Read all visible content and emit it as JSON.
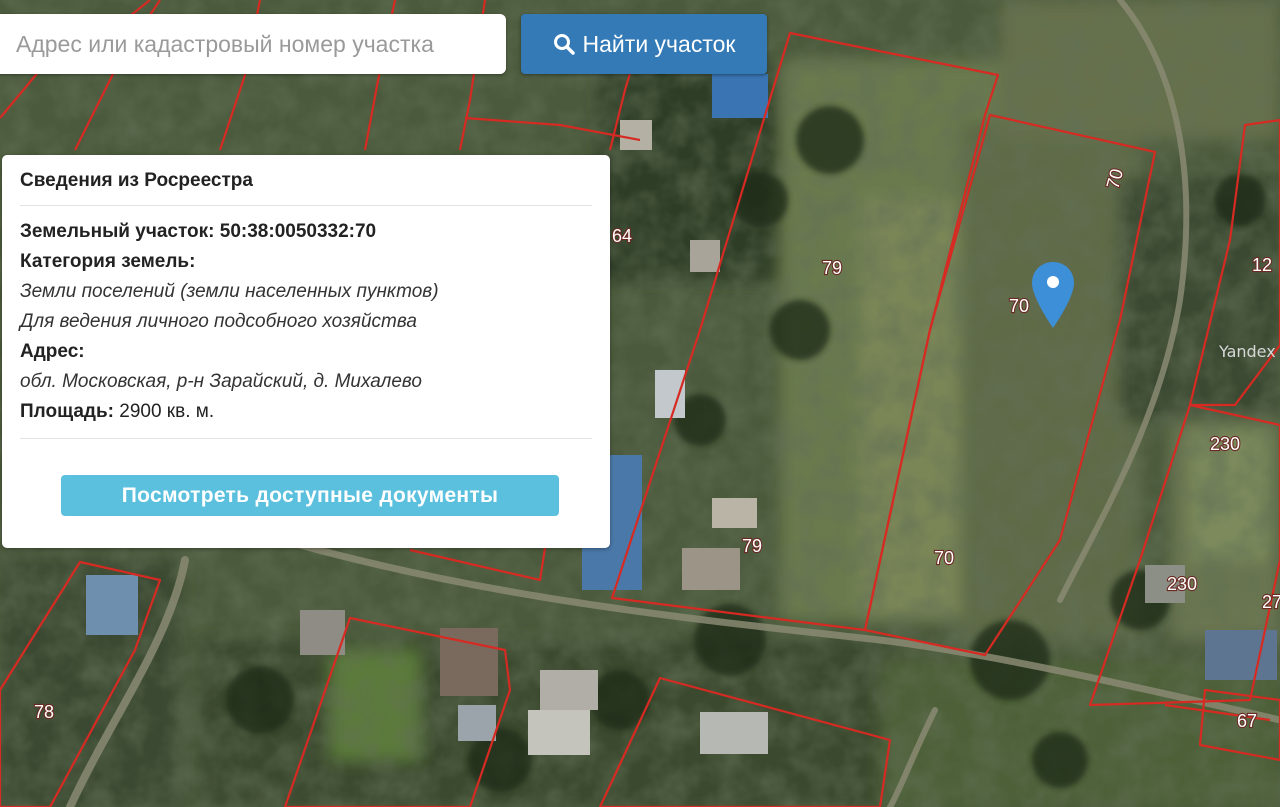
{
  "search": {
    "placeholder": "Адрес или кадастровый номер участка",
    "button_label": "Найти участок"
  },
  "info_panel": {
    "title": "Сведения из Росреестра",
    "parcel_label": "Земельный участок:",
    "parcel_number": "50:38:0050332:70",
    "category_label": "Категория земель:",
    "category_value": "Земли поселений (земли населенных пунктов)",
    "usage_value": "Для ведения личного подсобного хозяйства",
    "address_label": "Адрес:",
    "address_value": "обл. Московская, р-н Зарайский, д. Михалево",
    "area_label": "Площадь:",
    "area_value": "2900 кв. м.",
    "documents_button": "Посмотреть доступные документы"
  },
  "map": {
    "parcel_labels": [
      "64",
      "79",
      "70",
      "70",
      "12",
      "230",
      "79",
      "70",
      "230",
      "27",
      "78",
      "67"
    ],
    "provider": "Yandex",
    "marker_color": "#3d8fd8",
    "boundary_color": "#d62a22"
  },
  "icons": {
    "search_button_icon": "search-icon",
    "map_marker": "map-marker-icon"
  }
}
